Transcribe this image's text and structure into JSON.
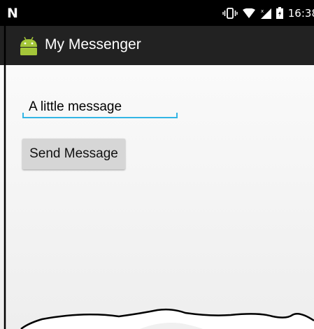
{
  "status_bar": {
    "carrier_logo": "N",
    "time": "16:38"
  },
  "action_bar": {
    "title": "My Messenger"
  },
  "message_input": {
    "value": "A little message"
  },
  "send_button": {
    "label": "Send Message"
  },
  "colors": {
    "status_bar_bg": "#000000",
    "action_bar_bg": "#222222",
    "accent": "#33b5e5",
    "android_green": "#a4c639",
    "button_bg": "#d6d6d6"
  }
}
